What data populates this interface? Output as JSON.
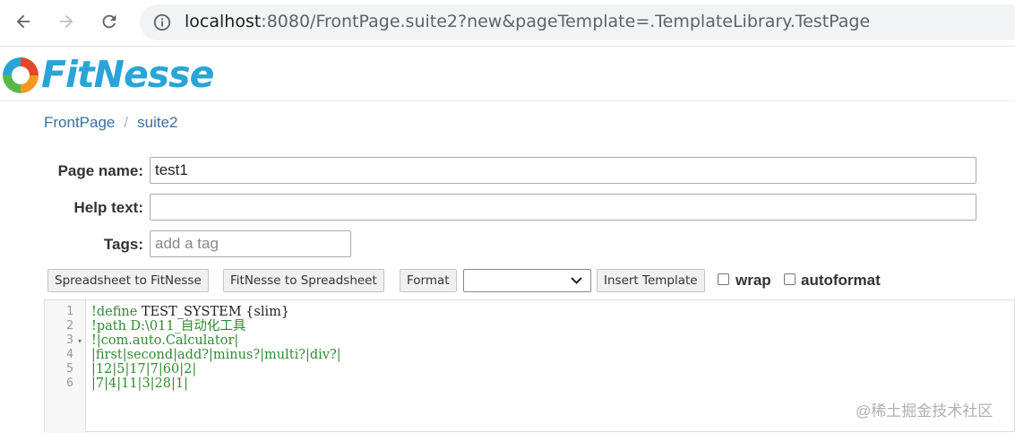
{
  "browser": {
    "url_host": "localhost",
    "url_rest": ":8080/FrontPage.suite2?new&pageTemplate=.TemplateLibrary.TestPage"
  },
  "app": {
    "logo_text": "FitNesse",
    "brand_color": "#2aa4d6"
  },
  "breadcrumb": {
    "items": [
      "FrontPage",
      "suite2"
    ],
    "separator": "/"
  },
  "form": {
    "page_name_label": "Page name:",
    "page_name_value": "test1",
    "help_text_label": "Help text:",
    "help_text_value": "",
    "tags_label": "Tags:",
    "tags_placeholder": "add a tag"
  },
  "toolbar": {
    "spreadsheet_to_fitnesse": "Spreadsheet to FitNesse",
    "fitnesse_to_spreadsheet": "FitNesse to Spreadsheet",
    "format": "Format",
    "template_select_value": "",
    "insert_template": "Insert Template",
    "wrap_label": "wrap",
    "autoformat_label": "autoformat"
  },
  "editor": {
    "line_numbers": [
      "1",
      "2",
      "3",
      "4",
      "5",
      "6"
    ],
    "lines": [
      {
        "prefix": "!define ",
        "rest": "TEST_SYSTEM {slim}"
      },
      {
        "prefix": "!path D:\\011_自动化工具",
        "rest": ""
      },
      {
        "prefix": "!|com.auto.Calculator|",
        "rest": ""
      },
      {
        "prefix": "|first|second|add?|minus?|multi?|div?|",
        "rest": ""
      },
      {
        "prefix": "|12|5|17|7|60|2|",
        "rest": ""
      },
      {
        "prefix": "|7|4|11|3|28|1|",
        "rest": ""
      }
    ],
    "code_color": "#2e8b2e"
  },
  "watermark": "@稀土掘金技术社区"
}
